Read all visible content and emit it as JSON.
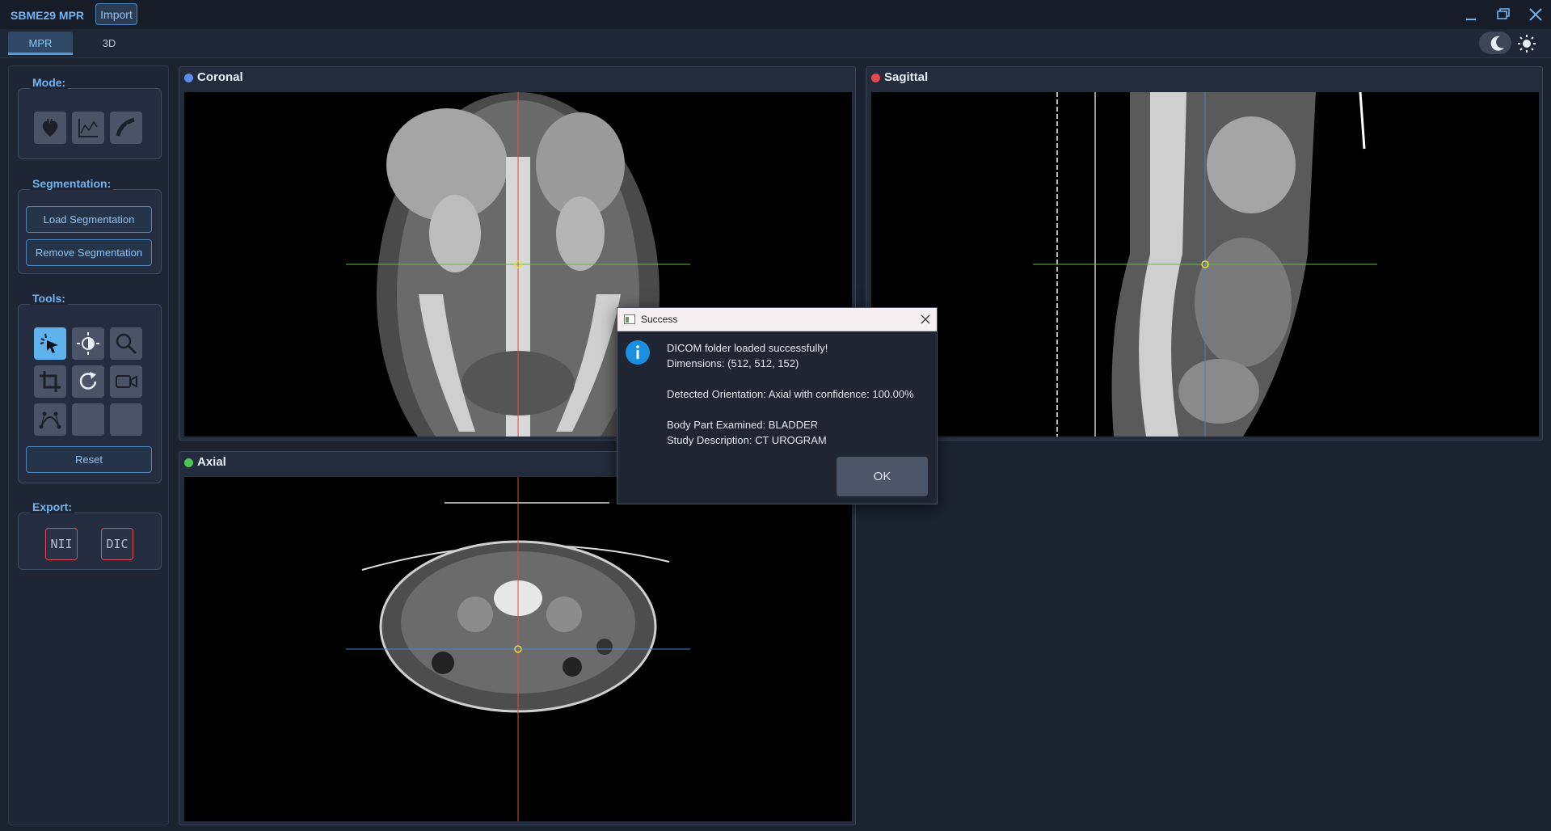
{
  "window": {
    "title": "SBME29 MPR",
    "import_label": "Import"
  },
  "tabs": [
    {
      "label": "MPR",
      "active": true
    },
    {
      "label": "3D",
      "active": false
    }
  ],
  "sidebar": {
    "mode": {
      "title": "Mode:",
      "buttons": [
        "heart-icon",
        "curve-chart-icon",
        "curved-ruler-icon"
      ]
    },
    "segmentation": {
      "title": "Segmentation:",
      "load_label": "Load Segmentation",
      "remove_label": "Remove Segmentation"
    },
    "tools": {
      "title": "Tools:",
      "buttons": [
        "pointer-icon",
        "contrast-icon",
        "zoom-icon",
        "crop-icon",
        "rotate-icon",
        "video-icon",
        "spline-icon",
        "empty",
        "empty"
      ],
      "reset_label": "Reset"
    },
    "export": {
      "title": "Export:",
      "nii_label": "NII",
      "dic_label": "DIC"
    }
  },
  "views": {
    "coronal": {
      "title": "Coronal",
      "dot_color": "#5b8def"
    },
    "sagittal": {
      "title": "Sagittal",
      "dot_color": "#e5484d"
    },
    "axial": {
      "title": "Axial",
      "dot_color": "#4fc35b"
    }
  },
  "dialog": {
    "title": "Success",
    "line1": "DICOM folder loaded successfully!",
    "line2": "Dimensions: (512, 512, 152)",
    "line3": "Detected Orientation: Axial with confidence: 100.00%",
    "line4": "Body Part Examined: BLADDER",
    "line5": "Study Description: CT UROGRAM",
    "ok_label": "OK"
  },
  "colors": {
    "accent": "#6fb3f2",
    "crosshair_vertical": "#e5484d",
    "crosshair_horizontal_coronal": "#5fbf3c",
    "crosshair_horizontal_axial": "#4a7fd4"
  }
}
